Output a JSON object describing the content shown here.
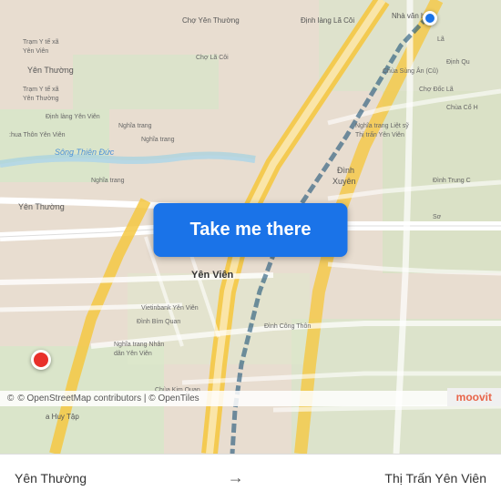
{
  "map": {
    "attribution": "© OpenStreetMap contributors | © OpenTiles",
    "moovit_logo": "moovit"
  },
  "button": {
    "cta_label": "Take me there"
  },
  "bottom_bar": {
    "from_label": "Yên Thường",
    "arrow": "→",
    "to_label": "Thị Trấn Yên Viên"
  },
  "markers": {
    "start_color": "#1a73e8",
    "end_color": "#e8302a"
  },
  "colors": {
    "road_main": "#f5c842",
    "road_secondary": "#ffffff",
    "road_highlight": "#f5c842",
    "water": "#aad3df",
    "green": "#c8e6c0",
    "map_bg": "#e8ddd0",
    "button_bg": "#1a73e8"
  }
}
